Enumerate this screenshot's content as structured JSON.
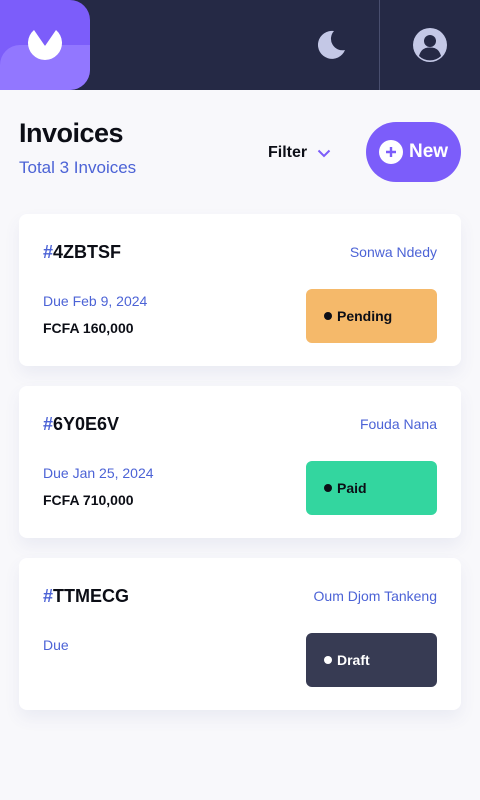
{
  "header": {
    "logo_icon": "logo-icon",
    "theme_icon": "moon-icon",
    "avatar_icon": "user-avatar-icon",
    "colors": {
      "bar": "#252945",
      "logo": "#7c5dfa",
      "logo_lower": "#9277ff"
    }
  },
  "page": {
    "title": "Invoices",
    "subtitle": "Total 3 Invoices",
    "filter_label": "Filter",
    "new_label": "New"
  },
  "invoices": [
    {
      "hash": "#",
      "id": "4ZBTSF",
      "client": "Sonwa Ndedy",
      "due": "Due Feb 9, 2024",
      "amount": "FCFA 160,000",
      "status": "Pending",
      "status_color": "#f5b96a"
    },
    {
      "hash": "#",
      "id": "6Y0E6V",
      "client": "Fouda Nana",
      "due": "Due Jan 25, 2024",
      "amount": "FCFA 710,000",
      "status": "Paid",
      "status_color": "#33d69f"
    },
    {
      "hash": "#",
      "id": "TTMECG",
      "client": "Oum Djom Tankeng",
      "due": "Due",
      "amount": "",
      "status": "Draft",
      "status_color": "#373b53"
    }
  ]
}
